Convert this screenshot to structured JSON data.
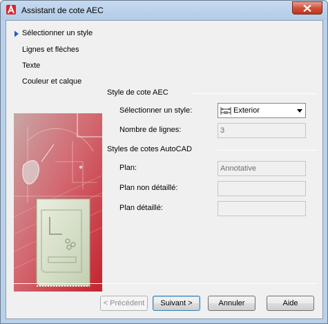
{
  "window": {
    "title": "Assistant de cote AEC"
  },
  "nav": {
    "items": [
      {
        "label": "Sélectionner un style",
        "active": true
      },
      {
        "label": "Lignes et flèches",
        "active": false
      },
      {
        "label": "Texte",
        "active": false
      },
      {
        "label": "Couleur et calque",
        "active": false
      }
    ]
  },
  "aec_section": {
    "title": "Style de cote AEC",
    "style_label": "Sélectionner un style:",
    "style_value": "Exterior",
    "lines_label": "Nombre de lignes:",
    "lines_value": "3"
  },
  "autocad_section": {
    "title": "Styles de cotes AutoCAD",
    "plan_label": "Plan:",
    "plan_value": "Annotative",
    "plan_non_detail_label": "Plan non détaillé:",
    "plan_non_detail_value": "",
    "plan_detail_label": "Plan détaillé:",
    "plan_detail_value": ""
  },
  "buttons": {
    "previous": "< Précédent",
    "next": "Suivant >",
    "cancel": "Annuler",
    "help": "Aide"
  },
  "colors": {
    "accent_red": "#c8343f",
    "nav_arrow": "#1f5fbf"
  }
}
